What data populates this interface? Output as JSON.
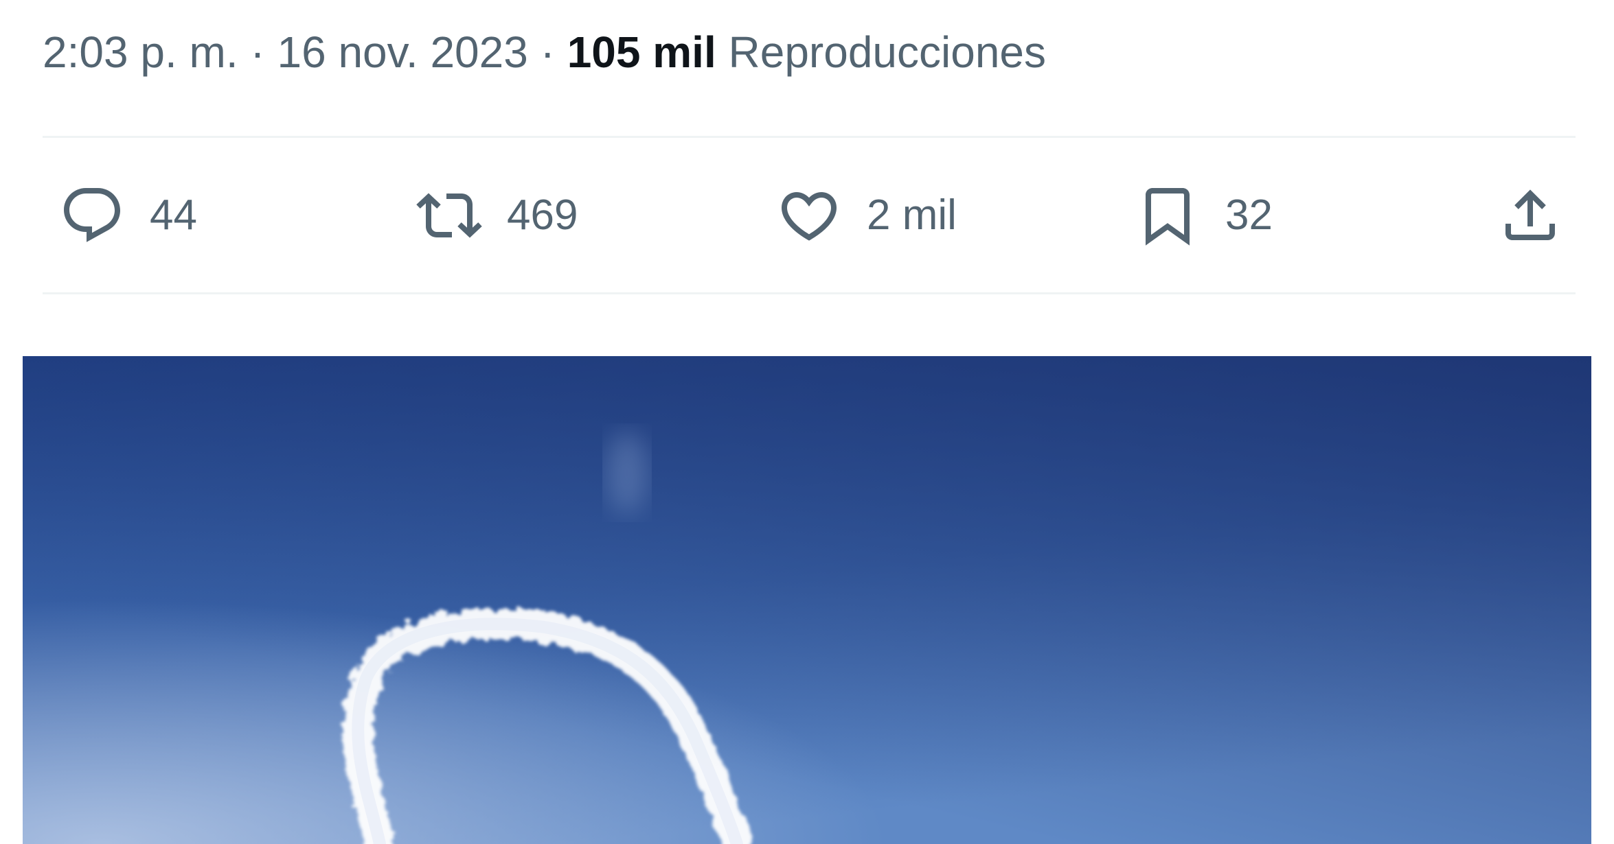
{
  "tweet": {
    "meta": {
      "time": "2:03 p. m.",
      "separator": "·",
      "date": "16 nov. 2023",
      "views_count": "105 mil",
      "views_label": "Reproducciones"
    },
    "actions": {
      "replies": {
        "icon": "reply-icon",
        "count": "44"
      },
      "retweets": {
        "icon": "retweet-icon",
        "count": "469"
      },
      "likes": {
        "icon": "heart-icon",
        "count": "2 mil"
      },
      "bookmarks": {
        "icon": "bookmark-icon",
        "count": "32"
      },
      "share": {
        "icon": "share-icon"
      }
    },
    "media": {
      "subject": "sky-photo-with-white-contrail-loop"
    }
  },
  "colors": {
    "text_primary": "#0f1419",
    "text_secondary": "#536471",
    "divider": "#eff3f4",
    "sky_top": "#1f3f85",
    "sky_bottom": "#5d86c4"
  }
}
